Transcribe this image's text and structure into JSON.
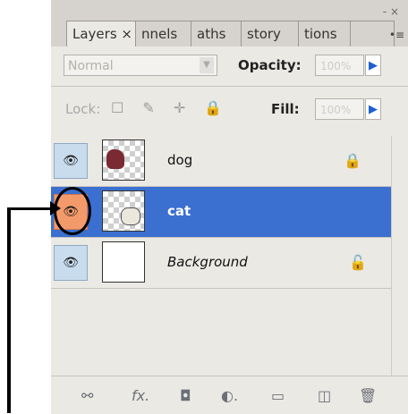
{
  "tabs": [
    {
      "label": "Layers ×",
      "active": true
    },
    {
      "label": "nnels"
    },
    {
      "label": "aths"
    },
    {
      "label": "story"
    },
    {
      "label": "tions"
    }
  ],
  "panel_controls": {
    "close": "- ×",
    "menu": "•≡"
  },
  "blend_mode": {
    "value": "Normal",
    "dropdown": "▼"
  },
  "opacity": {
    "label": "Opacity:",
    "value": "100%",
    "arrow": "▶"
  },
  "lock": {
    "label": "Lock:",
    "icons": "☐ ✎ ✛ 🔒"
  },
  "fill": {
    "label": "Fill:",
    "value": "100%",
    "arrow": "▶"
  },
  "layers": [
    {
      "name": "dog",
      "visible": true,
      "selected": false,
      "locked": "🔒"
    },
    {
      "name": "cat",
      "visible": true,
      "selected": true,
      "locked": ""
    },
    {
      "name": "Background",
      "visible": true,
      "selected": false,
      "locked": "🔓"
    }
  ],
  "eye_glyph": "👁",
  "footer_icons": [
    "link-icon",
    "fx-icon",
    "mask-icon",
    "adjustment-icon",
    "group-icon",
    "new-layer-icon",
    "trash-icon"
  ],
  "footer_glyphs": {
    "link": "⚯",
    "fx": "fx.",
    "mask": "◘",
    "adjust": "◐.",
    "group": "▭",
    "new": "◫",
    "trash": "🗑"
  },
  "colors": {
    "selected_row": "#3b6fd0",
    "highlight_eye": "#f39a6b"
  }
}
